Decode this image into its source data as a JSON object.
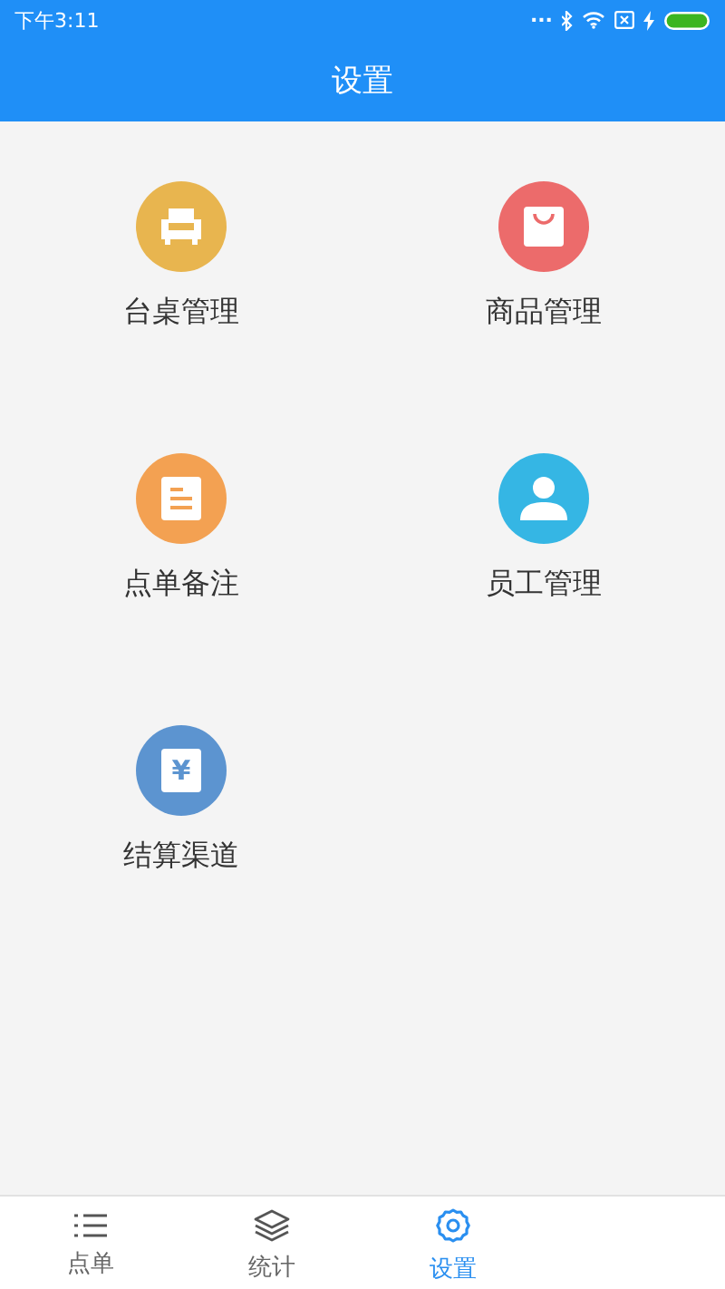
{
  "status_bar": {
    "time": "下午3:11",
    "dots": "..."
  },
  "header": {
    "title": "设置"
  },
  "items": [
    {
      "label": "台桌管理",
      "kind": "sofa",
      "color": "#e8b54f"
    },
    {
      "label": "商品管理",
      "kind": "bag",
      "color": "#ec6b6b"
    },
    {
      "label": "点单备注",
      "kind": "note",
      "color": "#f3a152"
    },
    {
      "label": "员工管理",
      "kind": "person",
      "color": "#35b6e4"
    },
    {
      "label": "结算渠道",
      "kind": "yen",
      "color": "#5c94d0",
      "symbol": "¥"
    }
  ],
  "tabs": [
    {
      "label": "点单",
      "kind": "list",
      "selected": false
    },
    {
      "label": "统计",
      "kind": "layers",
      "selected": false
    },
    {
      "label": "设置",
      "kind": "gear",
      "selected": true
    }
  ]
}
